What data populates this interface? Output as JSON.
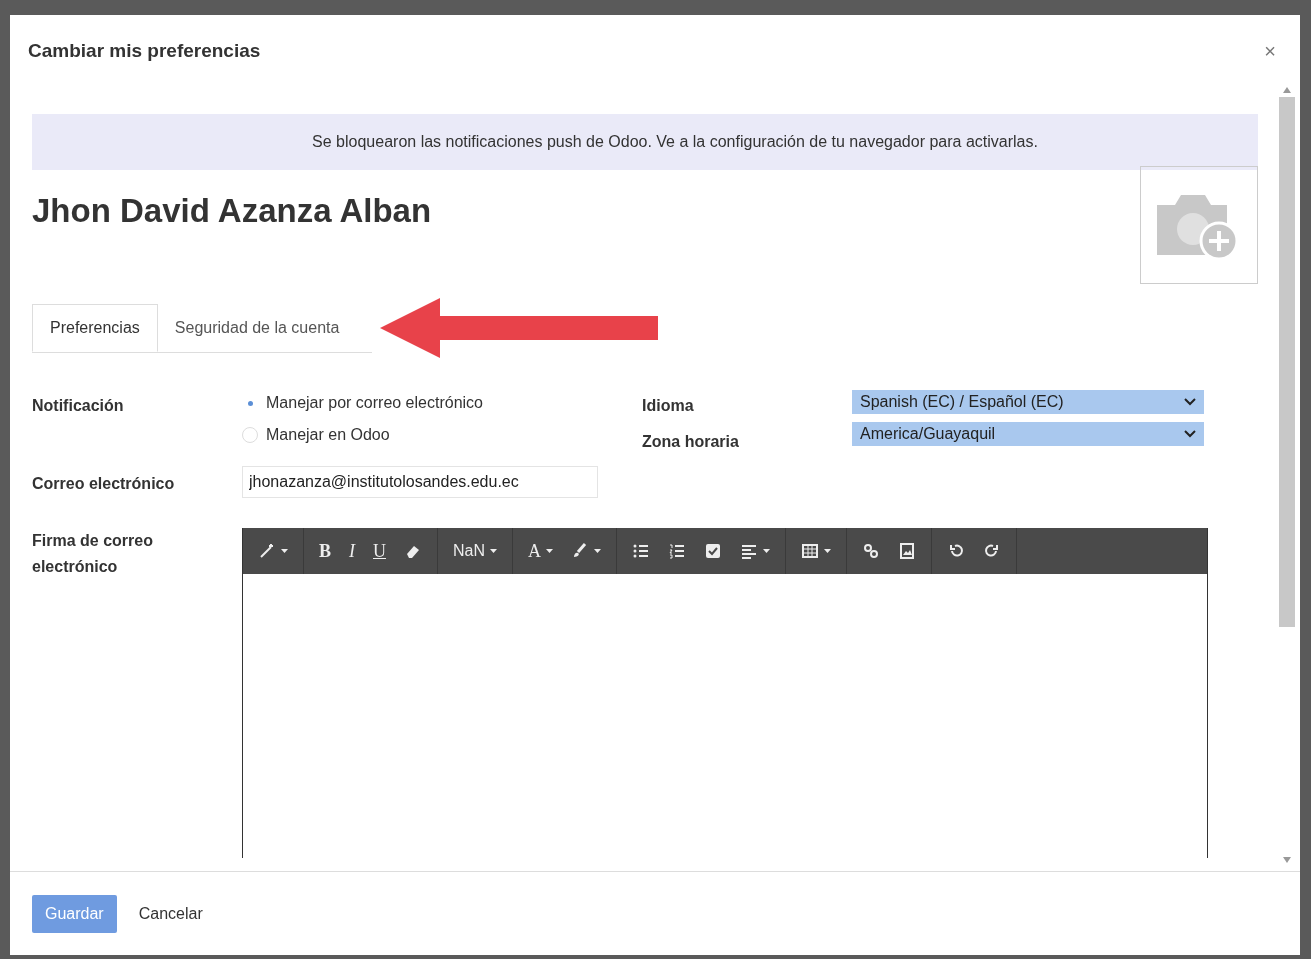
{
  "dialog": {
    "title": "Cambiar mis preferencias",
    "close": "×"
  },
  "alert": "Se bloquearon las notificaciones push de Odoo. Ve a la configuración de tu navegador para activarlas.",
  "user_name": "Jhon David Azanza Alban",
  "tabs": [
    {
      "label": "Preferencias",
      "selected": true
    },
    {
      "label": "Seguridad de la cuenta",
      "selected": false
    }
  ],
  "notification": {
    "label": "Notificación",
    "options": [
      {
        "label": "Manejar por correo electrónico",
        "selected": true
      },
      {
        "label": "Manejar en Odoo",
        "selected": false
      }
    ]
  },
  "language": {
    "label": "Idioma",
    "value": "Spanish (EC) / Español (EC)"
  },
  "timezone": {
    "label": "Zona horaria",
    "value": "America/Guayaquil"
  },
  "email": {
    "label": "Correo electrónico",
    "value": "jhonazanza@institutolosandes.edu.ec"
  },
  "signature": {
    "label": "Firma de correo electrónico",
    "toolbar": {
      "bold": "B",
      "italic": "I",
      "underline": "U",
      "font_size": "NaN",
      "font_color": "A"
    }
  },
  "buttons": [
    {
      "label": "Guardar",
      "kind": "primary"
    },
    {
      "label": "Cancelar",
      "kind": "link"
    }
  ]
}
